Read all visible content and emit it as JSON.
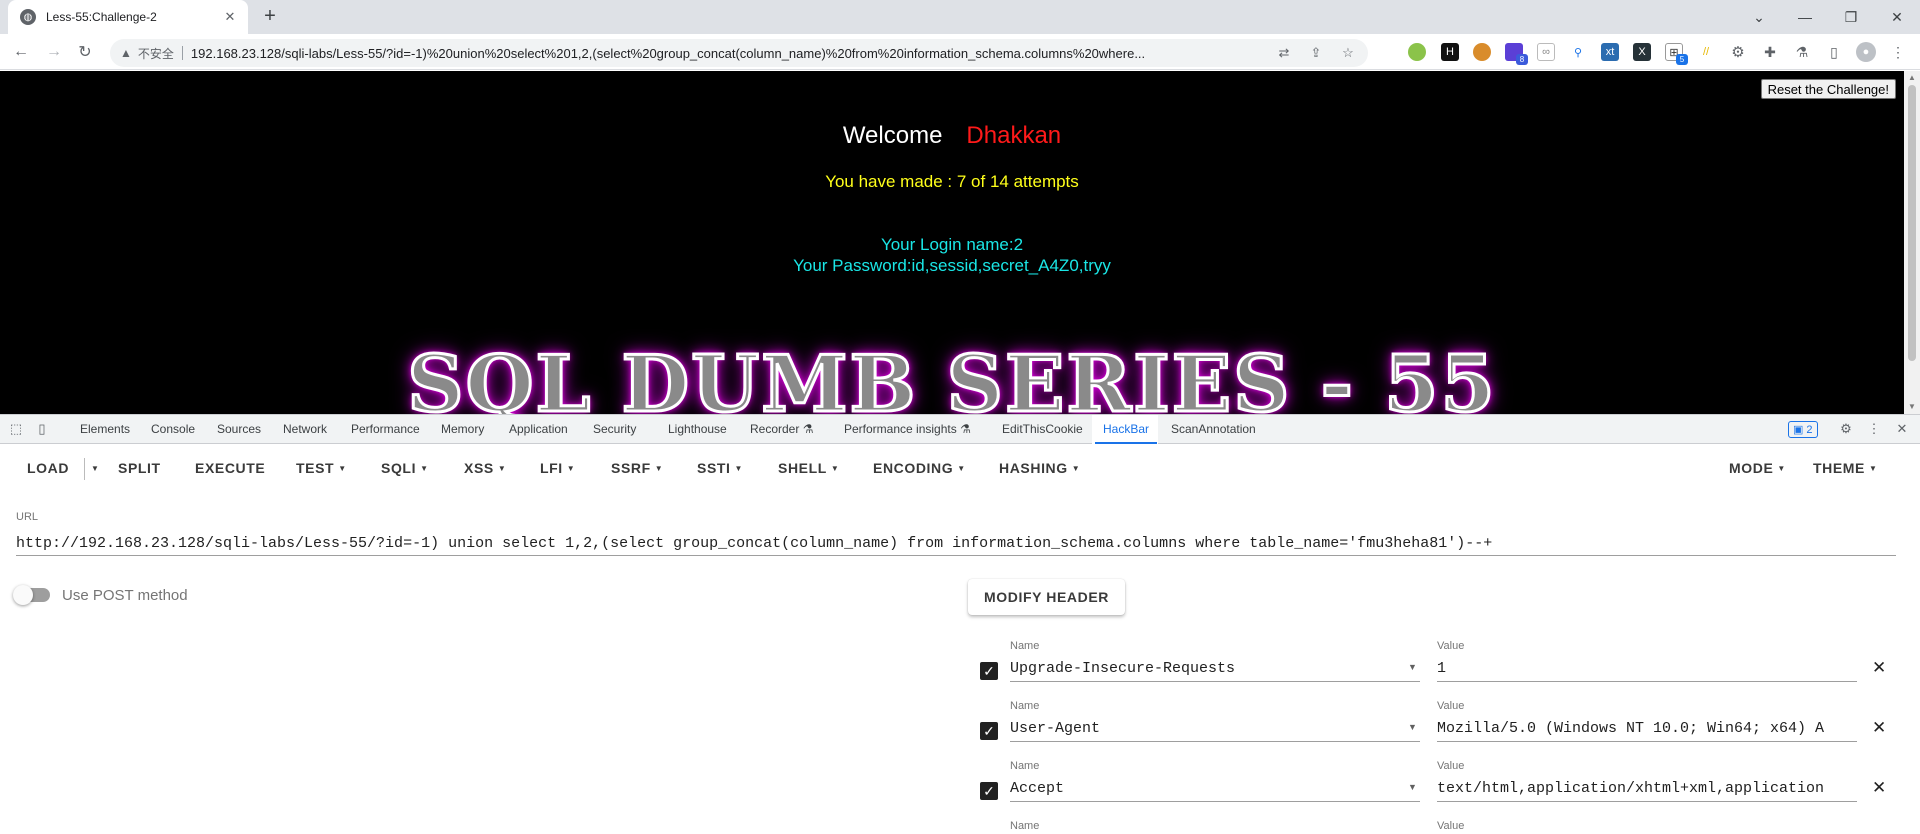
{
  "browser": {
    "tab_title": "Less-55:Challenge-2",
    "tab_close": "✕",
    "new_tab": "+",
    "security_label": "不安全",
    "address": "192.168.23.128/sqli-labs/Less-55/?id=-1)%20union%20select%201,2,(select%20group_concat(column_name)%20from%20information_schema.columns%20where...",
    "ext_badges": [
      "8",
      "5"
    ]
  },
  "page": {
    "reset_button": "Reset the Challenge!",
    "welcome": "Welcome",
    "username": "Dhakkan",
    "attempts": "You have made : 7 of 14 attempts",
    "login_name": "Your Login name:2",
    "password": "Your Password:id,sessid,secret_A4Z0,tryy",
    "banner": "SQL DUMB SERIES - 55"
  },
  "devtools": {
    "tabs": [
      "Elements",
      "Console",
      "Sources",
      "Network",
      "Performance",
      "Memory",
      "Application",
      "Security",
      "Lighthouse",
      "Recorder",
      "Performance insights",
      "EditThisCookie",
      "HackBar",
      "ScanAnnotation"
    ],
    "active_tab": "HackBar",
    "issues_count": "2"
  },
  "hackbar": {
    "menu": {
      "load": "LOAD",
      "split": "SPLIT",
      "execute": "EXECUTE",
      "test": "TEST",
      "sqli": "SQLI",
      "xss": "XSS",
      "lfi": "LFI",
      "ssrf": "SSRF",
      "ssti": "SSTI",
      "shell": "SHELL",
      "encoding": "ENCODING",
      "hashing": "HASHING",
      "mode": "MODE",
      "theme": "THEME"
    },
    "url_label": "URL",
    "url_value": "http://192.168.23.128/sqli-labs/Less-55/?id=-1) union select 1,2,(select group_concat(column_name) from information_schema.columns where table_name='fmu3heha81')--+",
    "post_label": "Use POST method",
    "modify_header": "MODIFY HEADER",
    "headers": [
      {
        "name_label": "Name",
        "name": "Upgrade-Insecure-Requests",
        "value_label": "Value",
        "value": "1"
      },
      {
        "name_label": "Name",
        "name": "User-Agent",
        "value_label": "Value",
        "value": "Mozilla/5.0 (Windows NT 10.0; Win64; x64) A"
      },
      {
        "name_label": "Name",
        "name": "Accept",
        "value_label": "Value",
        "value": "text/html,application/xhtml+xml,application"
      },
      {
        "name_label": "Name",
        "name": "",
        "value_label": "Value",
        "value": ""
      }
    ]
  }
}
